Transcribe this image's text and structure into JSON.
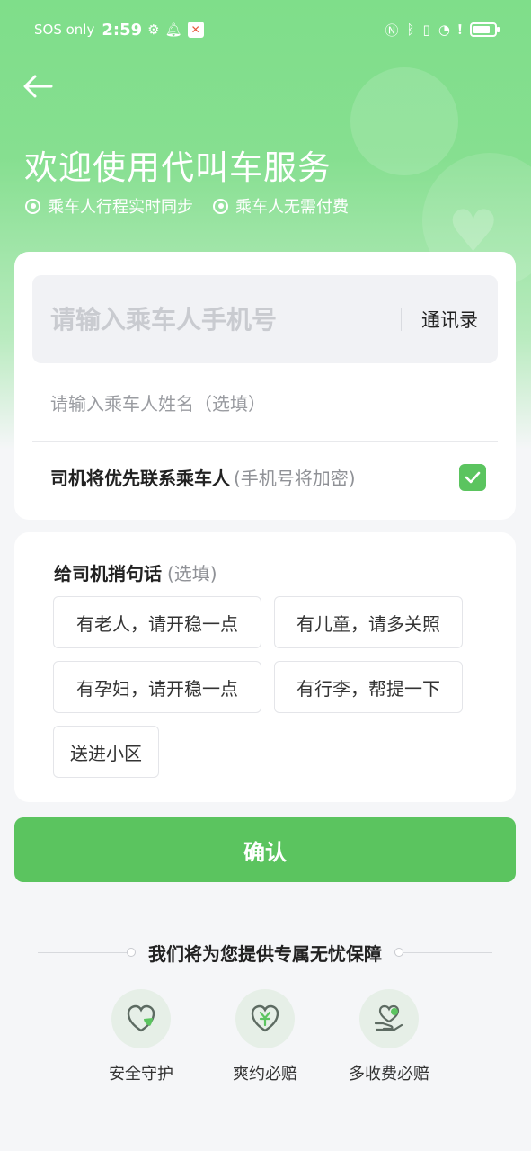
{
  "status_bar": {
    "carrier": "SOS only",
    "time": "2:59",
    "icons": [
      "gear-icon",
      "bell-icon",
      "app-notification-icon",
      "nfc-icon",
      "bluetooth-icon",
      "vibrate-icon",
      "wifi-icon",
      "alert-icon",
      "battery-icon"
    ]
  },
  "header": {
    "title": "欢迎使用代叫车服务",
    "features": [
      "乘车人行程实时同步",
      "乘车人无需付费"
    ]
  },
  "passenger": {
    "phone_placeholder": "请输入乘车人手机号",
    "contacts_label": "通讯录",
    "name_placeholder": "请输入乘车人姓名（选填）",
    "priority_label": "司机将优先联系乘车人",
    "priority_hint": "(手机号将加密)",
    "priority_checked": true
  },
  "message": {
    "title": "给司机捎句话",
    "hint": "(选填)",
    "chips": [
      "有老人，请开稳一点",
      "有儿童，请多关照",
      "有孕妇，请开稳一点",
      "有行李，帮提一下",
      "送进小区"
    ]
  },
  "confirm_label": "确认",
  "guarantee": {
    "title": "我们将为您提供专属无忧保障",
    "items": [
      {
        "label": "安全守护",
        "icon": "shield-heart-icon"
      },
      {
        "label": "爽约必赔",
        "icon": "yuan-heart-icon"
      },
      {
        "label": "多收费必赔",
        "icon": "hand-heart-icon"
      }
    ]
  },
  "colors": {
    "brand_green": "#5bc45f",
    "header_green": "#7fde8a"
  }
}
